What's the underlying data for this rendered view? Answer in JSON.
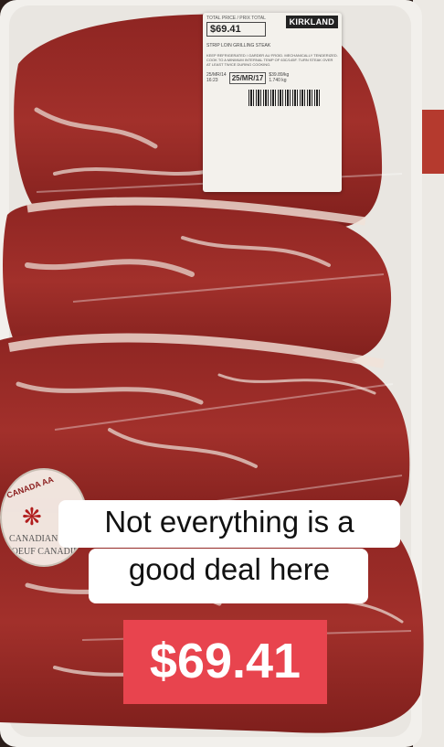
{
  "label": {
    "price_label": "TOTAL PRICE / PRIX TOTAL",
    "price": "$69.41",
    "brand": "KIRKLAND",
    "product": "STRIP LOIN GRILLING STEAK",
    "fine_print": "KEEP REFRIGERATED / GARDER AU FROID. MECHANICALLY TENDERIZED. COOK TO A MINIMUM INTERNAL TEMP OF 63C/145F. TURN STEAK OVER AT LEAST TWICE DURING COOKING.",
    "packed": "25/MR/14",
    "time": "16:23",
    "best_before": "25/MR/17",
    "unit_price": "$39.89/kg",
    "weight": "1.740 kg"
  },
  "seal": {
    "top": "CANADA AA",
    "line1": "CANADIAN BEEF",
    "line2": "BOEUF CANADIEN"
  },
  "caption": {
    "line1": "Not everything is a",
    "line2": "good deal here"
  },
  "price_overlay": "$69.41",
  "colors": {
    "caption_bg": "#ffffff",
    "price_bg": "#e8444e",
    "tray": "#f2f0ec",
    "meat": "#9b2a26"
  }
}
